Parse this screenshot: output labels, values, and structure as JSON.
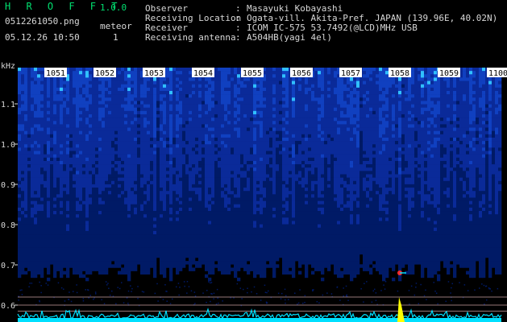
{
  "header": {
    "app_name": "H R O F F T",
    "version": "1.0.0",
    "file_name": "0512261050.png",
    "timestamp": "05.12.26 10:50",
    "meteor_label": "meteor",
    "meteor_count": "1"
  },
  "station_info": [
    {
      "label": "Observer",
      "value": "Masayuki Kobayashi"
    },
    {
      "label": "Receiving Location",
      "value": "Ogata-vill. Akita-Pref. JAPAN (139.96E, 40.02N)"
    },
    {
      "label": "Receiver",
      "value": "ICOM IC-575 53.7492(@LCD)MHz USB"
    },
    {
      "label": "Receiving antenna",
      "value": "A504HB(yagi 4el)"
    }
  ],
  "separator": ":",
  "colors": {
    "background": "#000000",
    "title_green": "#00e070",
    "text": "#d8d8d8",
    "tick_label_bg": "#ffffff",
    "noise_dark": "#001a66",
    "noise_mid": "#1040c0",
    "noise_bright": "#30c0ff",
    "trace_cyan": "#00e0ff",
    "meteor_yellow": "#ffff00"
  },
  "chart_data": {
    "type": "heatmap",
    "ylabel": "kHz",
    "y_ticks": [
      "1.1",
      "1.0",
      "0.9",
      "0.8",
      "0.7",
      "0.6"
    ],
    "y_values": [
      1.1,
      1.0,
      0.9,
      0.8,
      0.7,
      0.6
    ],
    "ylim": [
      0.57,
      1.16
    ],
    "time_ticks": [
      "1051",
      "1052",
      "1053",
      "1054",
      "1055",
      "1056",
      "1057",
      "1058",
      "1059",
      "1100"
    ],
    "xlim_minutes": [
      50,
      60
    ],
    "meteor_echo": {
      "time": "1056.9",
      "freq_khz": 0.68
    }
  }
}
